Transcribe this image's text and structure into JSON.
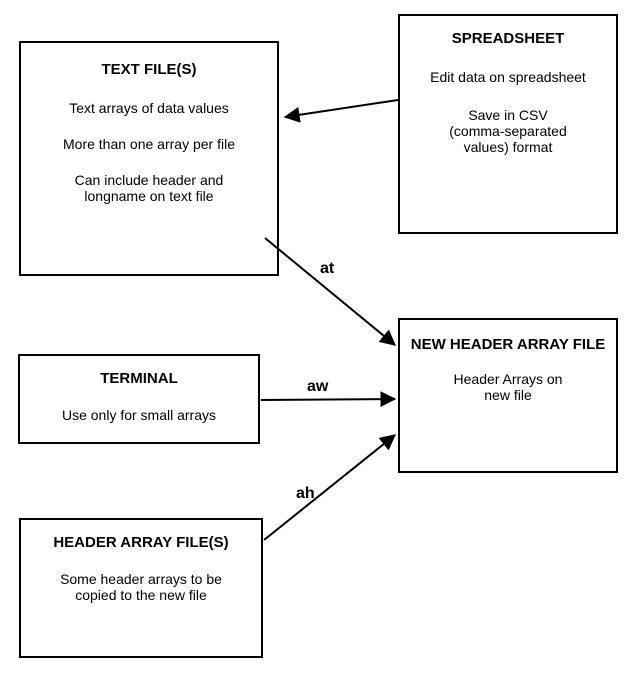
{
  "boxes": {
    "textfile": {
      "title": "TEXT FILE(S)",
      "l1": "Text arrays of data values",
      "l2": "More than one array per file",
      "l3": "Can include header and\nlongname on text file"
    },
    "spreadsheet": {
      "title": "SPREADSHEET",
      "l1": "Edit data on spreadsheet",
      "l2": "Save in CSV\n(comma-separated\nvalues) format"
    },
    "terminal": {
      "title": "TERMINAL",
      "l1": "Use only for small arrays"
    },
    "header": {
      "title": "HEADER ARRAY\nFILE(S)",
      "l1": "Some header arrays to be\ncopied to the new file"
    },
    "newfile": {
      "title": "NEW HEADER\nARRAY FILE",
      "l1": "Header Arrays on\nnew file"
    }
  },
  "labels": {
    "at": "at",
    "aw": "aw",
    "ah": "ah"
  }
}
